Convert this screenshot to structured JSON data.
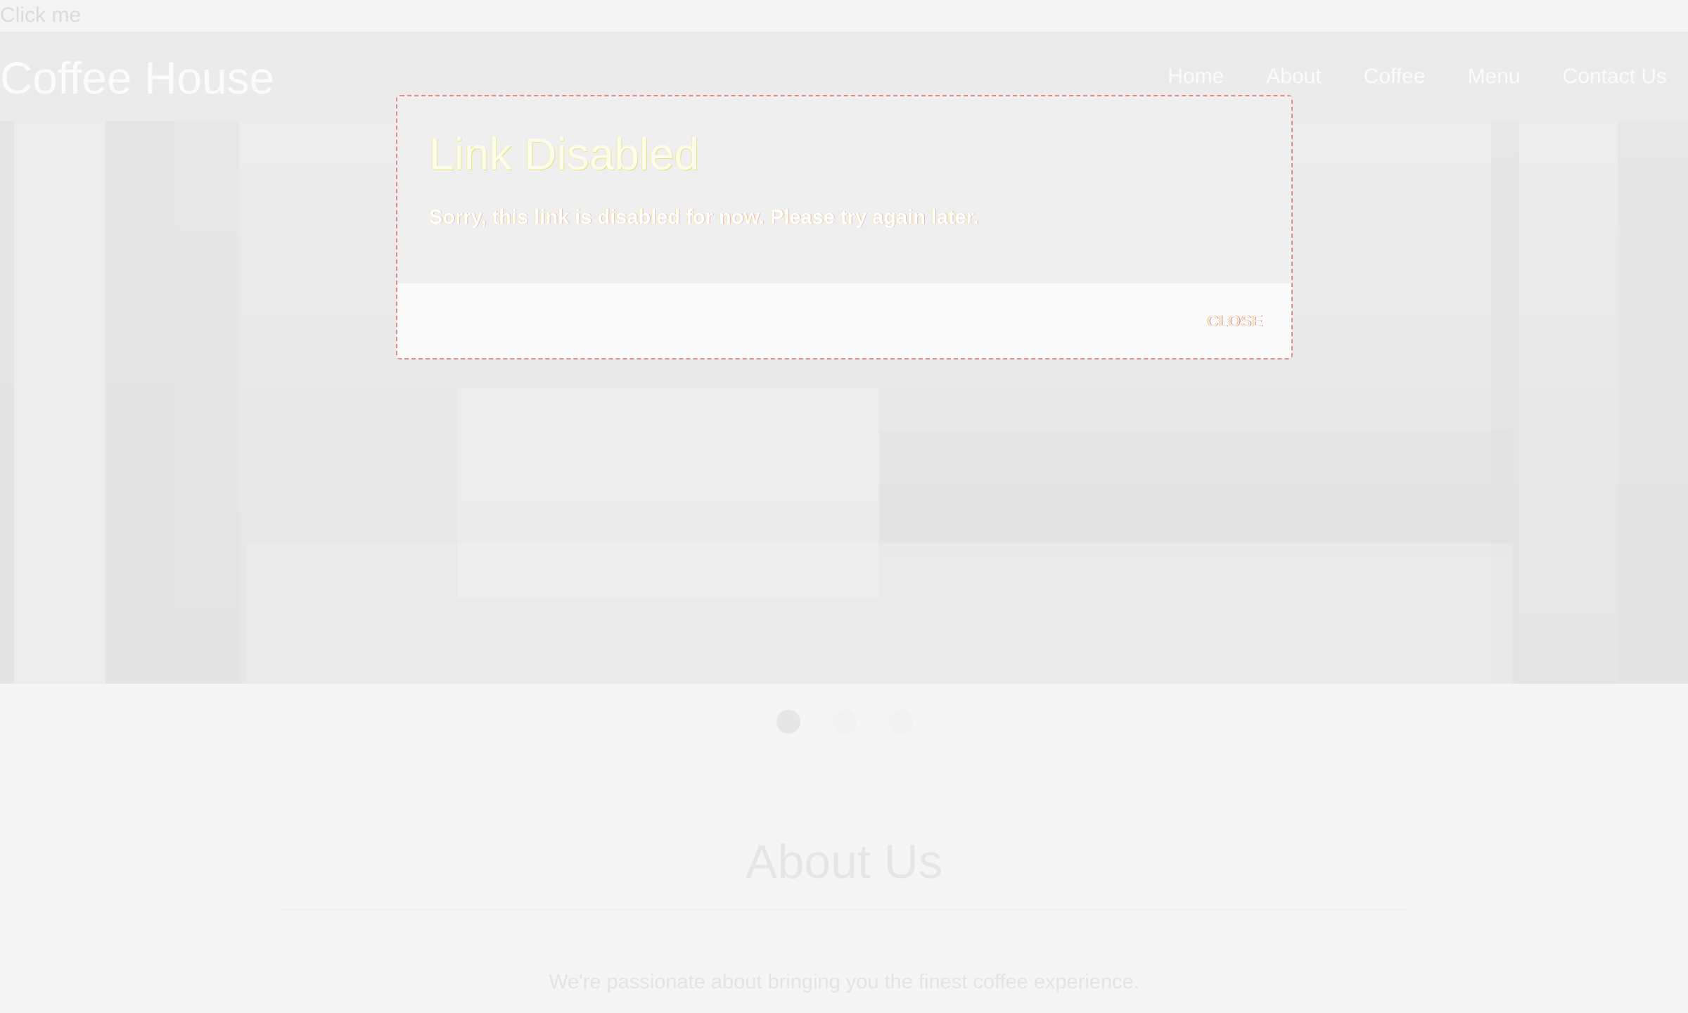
{
  "top": {
    "click_me": "Click me"
  },
  "navbar": {
    "brand": "Coffee House",
    "items": [
      "Home",
      "About",
      "Coffee",
      "Menu",
      "Contact Us"
    ]
  },
  "carousel": {
    "slides": 3,
    "active_index": 0
  },
  "about": {
    "title": "About Us",
    "text": "We're passionate about bringing you the finest coffee experience."
  },
  "modal": {
    "title": "Link Disabled",
    "message": "Sorry, this link is disabled for now. Please try again later.",
    "close_label": "CLOSE"
  }
}
